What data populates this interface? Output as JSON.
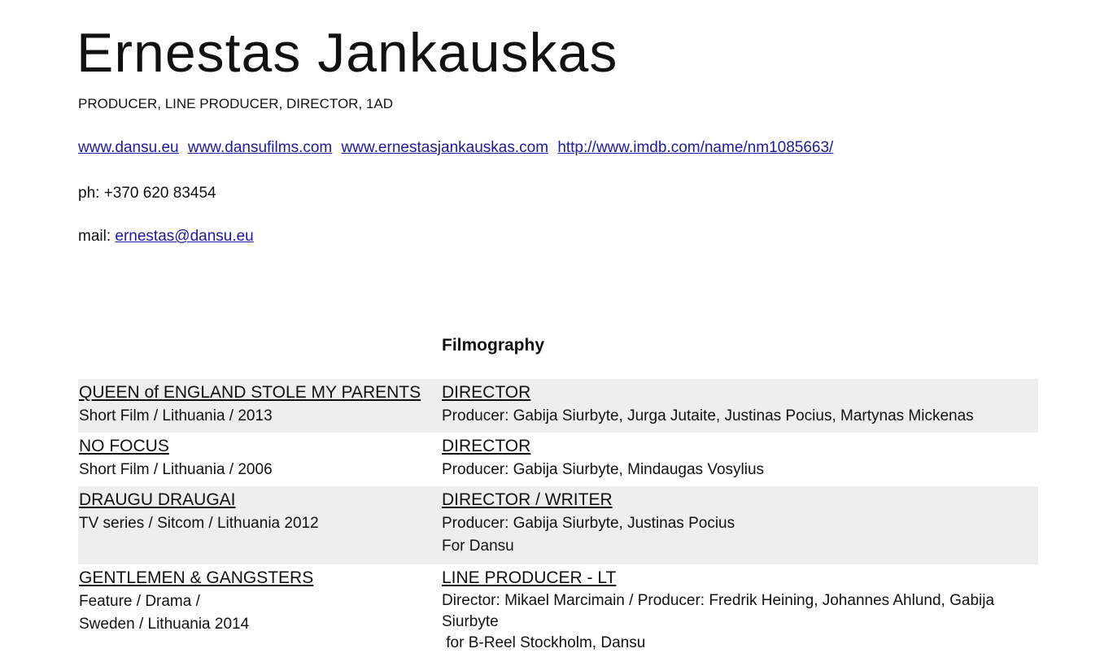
{
  "header": {
    "name": "Ernestas Jankauskas",
    "roles": "PRODUCER, LINE PRODUCER, DIRECTOR, 1AD"
  },
  "links": [
    "www.dansu.eu",
    "www.dansufilms.com",
    "www.ernestasjankauskas.com",
    "http://www.imdb.com/name/nm1085663/"
  ],
  "contact": {
    "phone": "ph: +370 620 83454",
    "email_label": "mail:",
    "email": "ernestas@dansu.eu"
  },
  "filmography": {
    "title": "Filmography",
    "entries": [
      {
        "title": "QUEEN of ENGLAND STOLE MY PARENTS",
        "details": [
          "Short Film / Lithuania / 2013"
        ],
        "role": "DIRECTOR",
        "credits": [
          "Producer: Gabija Siurbyte, Jurga Jutaite, Justinas Pocius, Martynas Mickenas"
        ]
      },
      {
        "title": "NO FOCUS",
        "details": [
          "Short Film / Lithuania / 2006"
        ],
        "role": "DIRECTOR",
        "credits": [
          "Producer: Gabija Siurbyte, Mindaugas Vosylius"
        ]
      },
      {
        "title": "DRAUGU DRAUGAI",
        "details": [
          "TV series / Sitcom / Lithuania 2012"
        ],
        "role": "DIRECTOR / WRITER",
        "credits": [
          "Producer: Gabija Siurbyte, Justinas Pocius",
          "For Dansu"
        ]
      },
      {
        "title": "GENTLEMEN & GANGSTERS",
        "details": [
          "Feature / Drama /",
          "Sweden / Lithuania 2014"
        ],
        "role": "LINE PRODUCER - LT",
        "credits": [
          "Director: Mikael Marcimain / Producer: Fredrik Heining, Johannes Ahlund, Gabija Siurbyte",
          " for B-Reel Stockholm, Dansu"
        ]
      }
    ]
  }
}
